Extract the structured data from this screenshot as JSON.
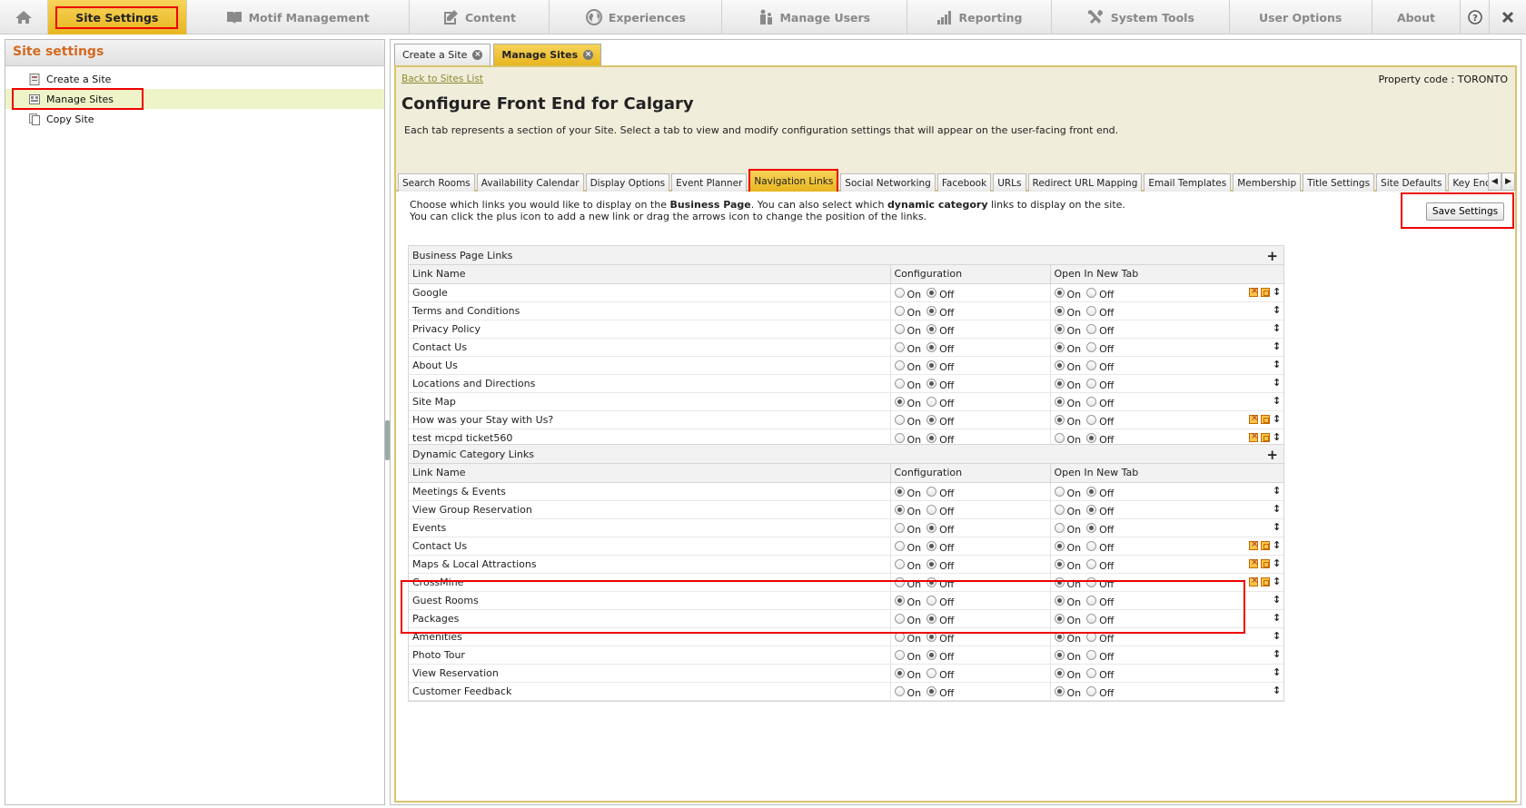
{
  "nav": {
    "home_icon": "home-icon",
    "items": [
      {
        "label": "Site Settings",
        "icon": ""
      },
      {
        "label": "Motif Management",
        "icon": "book-icon"
      },
      {
        "label": "Content",
        "icon": "edit-icon"
      },
      {
        "label": "Experiences",
        "icon": "globe-icon"
      },
      {
        "label": "Manage Users",
        "icon": "users-icon"
      },
      {
        "label": "Reporting",
        "icon": "bar-chart-icon"
      },
      {
        "label": "System Tools",
        "icon": "tools-icon"
      },
      {
        "label": "User Options",
        "icon": ""
      },
      {
        "label": "About",
        "icon": ""
      }
    ],
    "help_icon": "help-icon",
    "close_icon": "close-icon"
  },
  "sidebar": {
    "title": "Site settings",
    "items": [
      {
        "label": "Create a Site",
        "icon": "create-site-icon"
      },
      {
        "label": "Manage Sites",
        "icon": "manage-sites-icon"
      },
      {
        "label": "Copy Site",
        "icon": "copy-site-icon"
      }
    ]
  },
  "outer_tabs": [
    {
      "label": "Create a Site"
    },
    {
      "label": "Manage Sites"
    }
  ],
  "header": {
    "back_link": "Back to Sites List",
    "property_code": "Property code : TORONTO",
    "title": "Configure Front End for Calgary",
    "description": "Each tab represents a section of your Site. Select a tab to view and modify configuration settings that will appear on the user-facing front end."
  },
  "inner_tabs": [
    "Search Rooms",
    "Availability Calendar",
    "Display Options",
    "Event Planner",
    "Navigation Links",
    "Social Networking",
    "Facebook",
    "URLs",
    "Redirect URL Mapping",
    "Email Templates",
    "Membership",
    "Title Settings",
    "Site Defaults",
    "Key Encoder Settings"
  ],
  "instructions": {
    "line1_a": "Choose which links you would like to display on the ",
    "line1_b": "Business Page",
    "line1_c": ". You can also select which ",
    "line1_d": "dynamic category",
    "line1_e": " links to display on the site.",
    "line2": "You can click the plus icon to add a new link or drag the arrows icon to change the position of the links."
  },
  "save_button": "Save Settings",
  "labels": {
    "on": "On",
    "off": "Off"
  },
  "sections": [
    {
      "title": "Business Page Links",
      "columns": [
        "Link Name",
        "Configuration",
        "Open In New Tab"
      ],
      "rows": [
        {
          "name": "Google",
          "config": "off",
          "newtab": "on",
          "tools": true
        },
        {
          "name": "Terms and Conditions",
          "config": "off",
          "newtab": "on",
          "tools": false
        },
        {
          "name": "Privacy Policy",
          "config": "off",
          "newtab": "on",
          "tools": false
        },
        {
          "name": "Contact Us",
          "config": "off",
          "newtab": "on",
          "tools": false
        },
        {
          "name": "About Us",
          "config": "off",
          "newtab": "on",
          "tools": false
        },
        {
          "name": "Locations and Directions",
          "config": "off",
          "newtab": "on",
          "tools": false
        },
        {
          "name": "Site Map",
          "config": "on",
          "newtab": "on",
          "tools": false
        },
        {
          "name": "How was your Stay with Us?",
          "config": "off",
          "newtab": "on",
          "tools": true
        },
        {
          "name": "test mcpd ticket560",
          "config": "off",
          "newtab": "off",
          "tools": true
        }
      ]
    },
    {
      "title": "Dynamic Category Links",
      "columns": [
        "Link Name",
        "Configuration",
        "Open In New Tab"
      ],
      "rows": [
        {
          "name": "Meetings & Events",
          "config": "on",
          "newtab": "off",
          "tools": false
        },
        {
          "name": "View Group Reservation",
          "config": "on",
          "newtab": "off",
          "tools": false
        },
        {
          "name": "Events",
          "config": "off",
          "newtab": "off",
          "tools": false
        },
        {
          "name": "Contact Us",
          "config": "off",
          "newtab": "on",
          "tools": true
        },
        {
          "name": "Maps & Local Attractions",
          "config": "off",
          "newtab": "on",
          "tools": true
        },
        {
          "name": "CrossMine",
          "config": "off",
          "newtab": "on",
          "tools": true
        },
        {
          "name": "Guest Rooms",
          "config": "on",
          "newtab": "on",
          "tools": false
        },
        {
          "name": "Packages",
          "config": "off",
          "newtab": "on",
          "tools": false
        },
        {
          "name": "Amenities",
          "config": "off",
          "newtab": "on",
          "tools": false
        },
        {
          "name": "Photo Tour",
          "config": "off",
          "newtab": "on",
          "tools": false
        },
        {
          "name": "View Reservation",
          "config": "on",
          "newtab": "on",
          "tools": false
        },
        {
          "name": "Customer Feedback",
          "config": "off",
          "newtab": "on",
          "tools": false
        }
      ]
    }
  ]
}
